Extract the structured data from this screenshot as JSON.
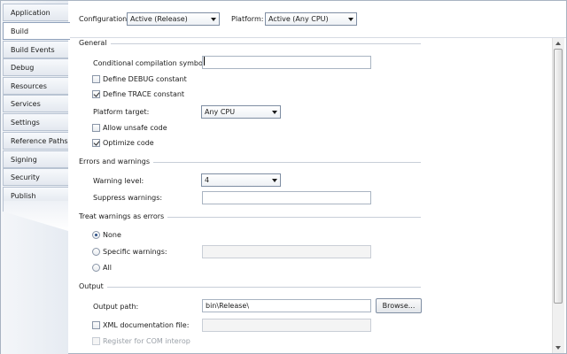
{
  "sidebar": {
    "tabs": [
      {
        "label": "Application",
        "active": false
      },
      {
        "label": "Build",
        "active": true
      },
      {
        "label": "Build Events",
        "active": false
      },
      {
        "label": "Debug",
        "active": false
      },
      {
        "label": "Resources",
        "active": false
      },
      {
        "label": "Services",
        "active": false
      },
      {
        "label": "Settings",
        "active": false
      },
      {
        "label": "Reference Paths",
        "active": false
      },
      {
        "label": "Signing",
        "active": false
      },
      {
        "label": "Security",
        "active": false
      },
      {
        "label": "Publish",
        "active": false
      }
    ]
  },
  "topbar": {
    "configuration_label": "Configuration:",
    "configuration_value": "Active (Release)",
    "platform_label": "Platform:",
    "platform_value": "Active (Any CPU)"
  },
  "general": {
    "title": "General",
    "conditional_symbols_label": "Conditional compilation symbols:",
    "conditional_symbols_value": "",
    "define_debug_label": "Define DEBUG constant",
    "define_debug_checked": false,
    "define_trace_label": "Define TRACE constant",
    "define_trace_checked": true,
    "platform_target_label": "Platform target:",
    "platform_target_value": "Any CPU",
    "allow_unsafe_label": "Allow unsafe code",
    "allow_unsafe_checked": false,
    "optimize_label": "Optimize code",
    "optimize_checked": true
  },
  "errors": {
    "title": "Errors and warnings",
    "warning_level_label": "Warning level:",
    "warning_level_value": "4",
    "suppress_label": "Suppress warnings:",
    "suppress_value": ""
  },
  "treat_warnings": {
    "title": "Treat warnings as errors",
    "none_label": "None",
    "specific_label": "Specific warnings:",
    "specific_value": "",
    "all_label": "All",
    "selected": "None"
  },
  "output": {
    "title": "Output",
    "output_path_label": "Output path:",
    "output_path_value": "bin\\Release\\",
    "browse_label": "Browse...",
    "xml_doc_label": "XML documentation file:",
    "xml_doc_value": "",
    "com_interop_label": "Register for COM interop"
  },
  "colors": {
    "tab_border": "#b8c3d2",
    "radio_dot": "#2b4f86",
    "section_line": "#c8ced8"
  }
}
